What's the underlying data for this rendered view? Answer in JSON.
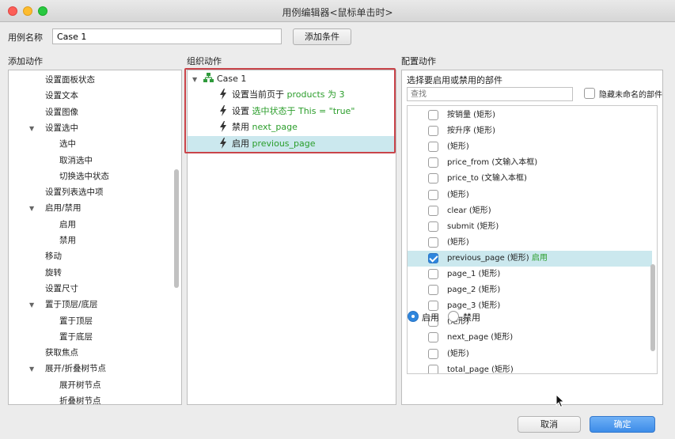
{
  "window": {
    "title": "用例编辑器<鼠标单击时>"
  },
  "case_name": {
    "label": "用例名称",
    "value": "Case 1",
    "add_condition_label": "添加条件"
  },
  "sections": {
    "add_actions": "添加动作",
    "organize_actions": "组织动作",
    "configure_actions": "配置动作"
  },
  "add_actions": [
    {
      "label": "设置面板状态",
      "level": 1,
      "expander": false
    },
    {
      "label": "设置文本",
      "level": 1,
      "expander": false
    },
    {
      "label": "设置图像",
      "level": 1,
      "expander": false
    },
    {
      "label": "设置选中",
      "level": 1,
      "expander": true
    },
    {
      "label": "选中",
      "level": 2,
      "expander": false
    },
    {
      "label": "取消选中",
      "level": 2,
      "expander": false
    },
    {
      "label": "切换选中状态",
      "level": 2,
      "expander": false
    },
    {
      "label": "设置列表选中项",
      "level": 1,
      "expander": false
    },
    {
      "label": "启用/禁用",
      "level": 1,
      "expander": true
    },
    {
      "label": "启用",
      "level": 2,
      "expander": false
    },
    {
      "label": "禁用",
      "level": 2,
      "expander": false
    },
    {
      "label": "移动",
      "level": 1,
      "expander": false
    },
    {
      "label": "旋转",
      "level": 1,
      "expander": false
    },
    {
      "label": "设置尺寸",
      "level": 1,
      "expander": false
    },
    {
      "label": "置于顶层/底层",
      "level": 1,
      "expander": true
    },
    {
      "label": "置于顶层",
      "level": 2,
      "expander": false
    },
    {
      "label": "置于底层",
      "level": 2,
      "expander": false
    },
    {
      "label": "获取焦点",
      "level": 1,
      "expander": false
    },
    {
      "label": "展开/折叠树节点",
      "level": 1,
      "expander": true
    },
    {
      "label": "展开树节点",
      "level": 2,
      "expander": false
    },
    {
      "label": "折叠树节点",
      "level": 2,
      "expander": false
    }
  ],
  "organize": {
    "case_label": "Case 1",
    "actions": [
      {
        "verb": "设置当前页于",
        "detail": "products 为 3",
        "selected": false
      },
      {
        "verb": "设置",
        "detail": "选中状态于 This = \"true\"",
        "selected": false
      },
      {
        "verb": "禁用",
        "detail": "next_page",
        "selected": false
      },
      {
        "verb": "启用",
        "detail": "previous_page",
        "selected": true
      }
    ]
  },
  "configure": {
    "title": "选择要启用或禁用的部件",
    "search_placeholder": "查找",
    "hide_unnamed_label": "隐藏未命名的部件",
    "widgets": [
      {
        "label": "按销量 (矩形)",
        "checked": false,
        "status": ""
      },
      {
        "label": "按升序 (矩形)",
        "checked": false,
        "status": ""
      },
      {
        "label": "(矩形)",
        "checked": false,
        "status": ""
      },
      {
        "label": "price_from (文输入本框)",
        "checked": false,
        "status": ""
      },
      {
        "label": "price_to (文输入本框)",
        "checked": false,
        "status": ""
      },
      {
        "label": "(矩形)",
        "checked": false,
        "status": ""
      },
      {
        "label": "clear (矩形)",
        "checked": false,
        "status": ""
      },
      {
        "label": "submit (矩形)",
        "checked": false,
        "status": ""
      },
      {
        "label": "(矩形)",
        "checked": false,
        "status": ""
      },
      {
        "label": "previous_page (矩形)",
        "checked": true,
        "status": "启用"
      },
      {
        "label": "page_1 (矩形)",
        "checked": false,
        "status": ""
      },
      {
        "label": "page_2 (矩形)",
        "checked": false,
        "status": ""
      },
      {
        "label": "page_3 (矩形)",
        "checked": false,
        "status": ""
      },
      {
        "label": "(矩形)",
        "checked": false,
        "status": ""
      },
      {
        "label": "next_page (矩形)",
        "checked": false,
        "status": ""
      },
      {
        "label": "(矩形)",
        "checked": false,
        "status": ""
      },
      {
        "label": "total_page (矩形)",
        "checked": false,
        "status": ""
      }
    ],
    "radio_enable": "启用",
    "radio_disable": "禁用",
    "selected_radio": "enable"
  },
  "buttons": {
    "cancel": "取消",
    "ok": "确定"
  },
  "colors": {
    "accent": "#2f86dd",
    "selection": "#cbe8ee",
    "highlight_frame": "#c9444a",
    "green_text": "#2a9d2a"
  }
}
